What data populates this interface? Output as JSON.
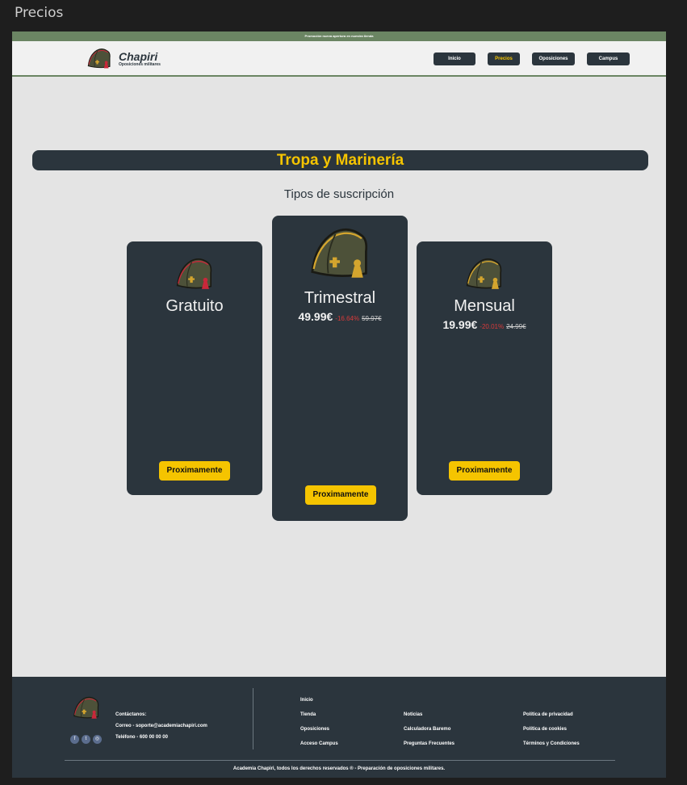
{
  "window": {
    "title": "Precios"
  },
  "promo": {
    "text": "Promoción nueva apertura en nuestra tienda"
  },
  "brand": {
    "name": "Chapiri",
    "tagline": "Oposiciones militares"
  },
  "nav": {
    "items": [
      {
        "label": "Inicio",
        "active": false
      },
      {
        "label": "Precios",
        "active": true
      },
      {
        "label": "Oposiciones",
        "active": false
      },
      {
        "label": "Campus",
        "active": false
      }
    ]
  },
  "section": {
    "title": "Tropa y Marinería",
    "subtitle": "Tipos de suscripción"
  },
  "plans": [
    {
      "name": "Gratuito",
      "price": "",
      "discount": "",
      "old_price": "",
      "cta": "Proximamente"
    },
    {
      "name": "Trimestral",
      "price": "49.99€",
      "discount": "-16.64%",
      "old_price": "59.97€",
      "cta": "Proximamente"
    },
    {
      "name": "Mensual",
      "price": "19.99€",
      "discount": "-20.01%",
      "old_price": "24.99€",
      "cta": "Proximamente"
    }
  ],
  "footer": {
    "contact_heading": "Contáctanos:",
    "email": "Correo - soporte@academiachapiri.com",
    "phone": "Teléfono - 600 00 00 00",
    "col1": [
      "Inicio",
      "Tienda",
      "Oposiciones",
      "Acceso Campus"
    ],
    "col2": [
      "Noticias",
      "Calculadora Baremo",
      "Preguntas Frecuentes"
    ],
    "col3": [
      "Política de privacidad",
      "Política de cookies",
      "Términos y Condiciones"
    ],
    "copyright": "Academia Chapiri, todos los derechos reservados ® - Preparación de oposiciones militares."
  },
  "colors": {
    "dark": "#2b353d",
    "accent": "#f5c400",
    "green": "#6b8563",
    "discount": "#d83a3a"
  },
  "icons": {
    "logo": "garrison-cap-icon",
    "social": [
      "facebook-icon",
      "twitter-icon",
      "instagram-icon"
    ]
  }
}
